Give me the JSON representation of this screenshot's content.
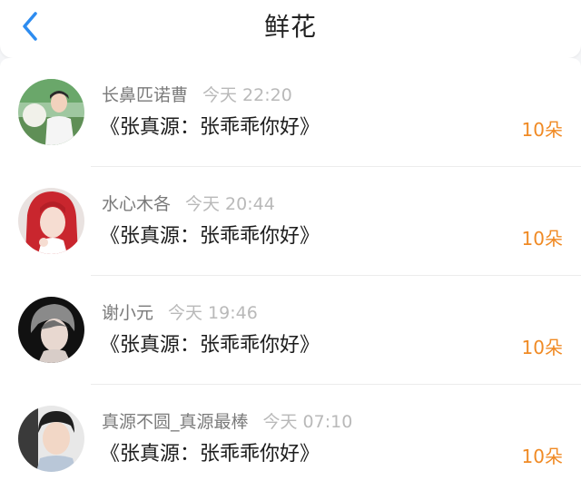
{
  "header": {
    "title": "鲜花",
    "back_icon": "chevron-left-icon",
    "accent_color": "#2d8cf0"
  },
  "colors": {
    "count": "#f08a24",
    "username": "#7a7a7a",
    "time": "#b9b9b9"
  },
  "items": [
    {
      "username": "长鼻匹诺曹",
      "time": "今天 22:20",
      "work": "《张真源：张乖乖你好》",
      "count": "10朵"
    },
    {
      "username": "水心木各",
      "time": "今天 20:44",
      "work": "《张真源：张乖乖你好》",
      "count": "10朵"
    },
    {
      "username": "谢小元",
      "time": "今天 19:46",
      "work": "《张真源：张乖乖你好》",
      "count": "10朵"
    },
    {
      "username": "真源不圆_真源最棒",
      "time": "今天 07:10",
      "work": "《张真源：张乖乖你好》",
      "count": "10朵"
    }
  ]
}
